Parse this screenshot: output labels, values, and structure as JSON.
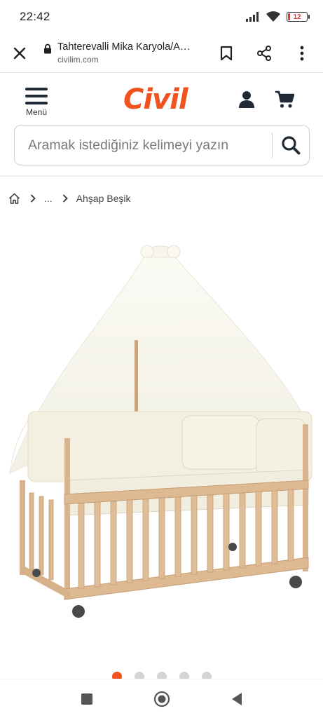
{
  "status": {
    "time": "22:42",
    "battery": "12",
    "battery_level_percent": 12,
    "battery_color": "#e53935"
  },
  "browser": {
    "page_title": "Tahterevalli Mika Karyola/A…",
    "domain": "civilim.com",
    "icons": [
      "close-icon",
      "lock-icon",
      "bookmark-icon",
      "share-icon",
      "more-icon"
    ]
  },
  "header": {
    "logo": "Civil",
    "menu_label": "Menü",
    "search_placeholder": "Aramak istediğiniz kelimeyi yazın",
    "brand_color": "#f0531d"
  },
  "breadcrumb": {
    "ellipsis": "...",
    "current": "Ahşap Beşik"
  },
  "carousel": {
    "total": 5,
    "active_index": 0
  }
}
